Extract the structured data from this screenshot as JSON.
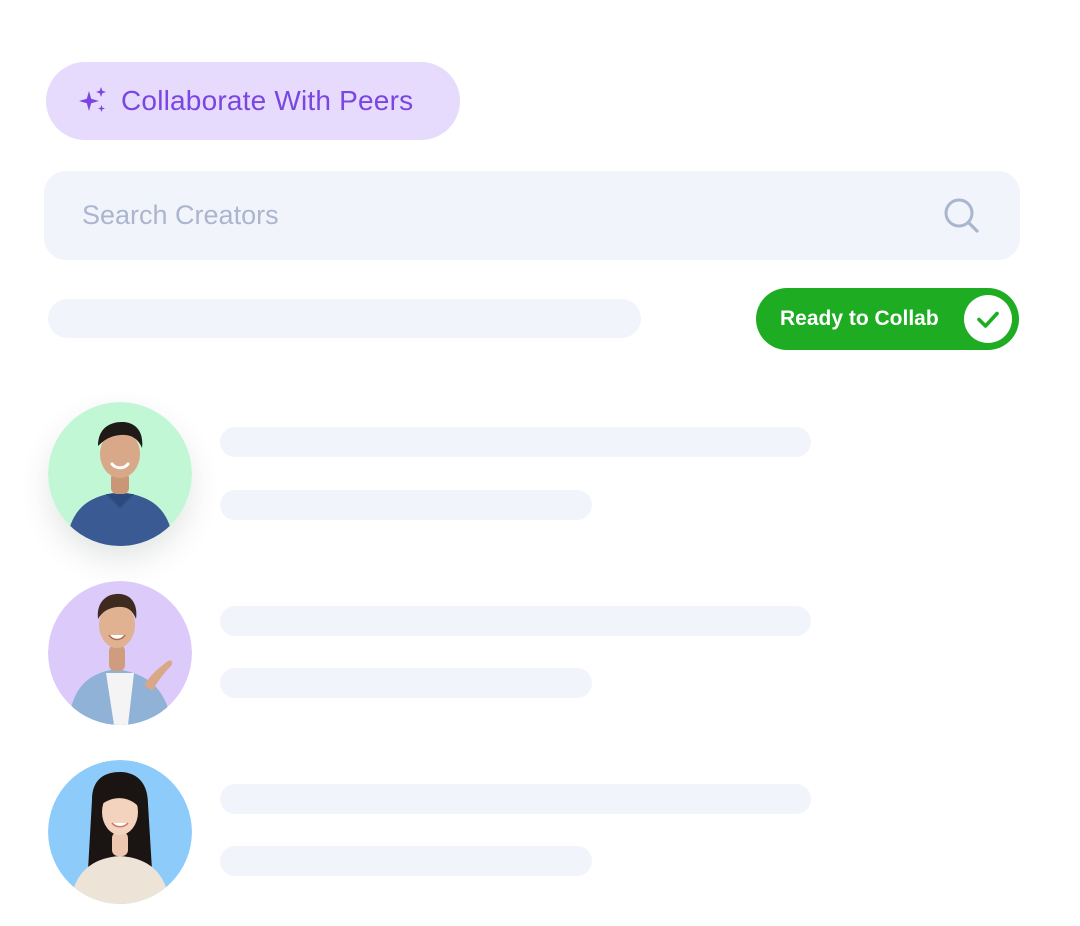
{
  "header": {
    "badge_label": "Collaborate With Peers",
    "badge_icon": "sparkle-icon",
    "badge_bg": "#e6dbfc",
    "badge_color": "#7a45e0"
  },
  "search": {
    "placeholder": "Search Creators",
    "value": "",
    "icon": "search-icon"
  },
  "status": {
    "label": "Ready to Collab",
    "checked": true,
    "icon": "check-icon",
    "color": "#1eac23"
  },
  "creators": [
    {
      "avatar_bg": "#c2f7d5",
      "description": "man in blue henley shirt"
    },
    {
      "avatar_bg": "#dccafb",
      "description": "man in denim shirt pointing"
    },
    {
      "avatar_bg": "#8dcbfb",
      "description": "woman in cream sweater"
    }
  ]
}
